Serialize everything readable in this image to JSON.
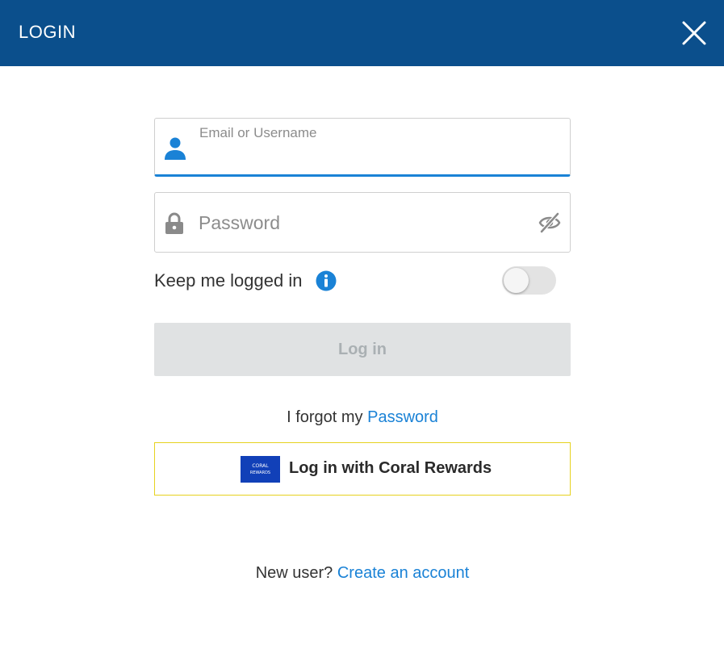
{
  "header": {
    "title": "LOGIN",
    "close_icon": "close-icon",
    "background": "#0b4f8c"
  },
  "email_field": {
    "label": "Email or Username",
    "value": "",
    "icon": "user-icon",
    "accent": "#1a82d6"
  },
  "password_field": {
    "placeholder": "Password",
    "value": "",
    "icon": "lock-icon",
    "toggle_icon": "eye-slash-icon"
  },
  "keep_logged_in": {
    "label": "Keep me logged in",
    "info_icon": "info-icon",
    "enabled": false
  },
  "login_button": {
    "label": "Log in",
    "disabled": true
  },
  "forgot": {
    "prefix": "I forgot my ",
    "link": "Password"
  },
  "rewards_button": {
    "label": "Log in with Coral Rewards",
    "logo": "coral-rewards-logo",
    "logo_text_top": "CORAL",
    "logo_text_bottom": "REWARDS",
    "border_color": "#e6d21f"
  },
  "new_user": {
    "prefix": "New user? ",
    "link": "Create an account"
  }
}
